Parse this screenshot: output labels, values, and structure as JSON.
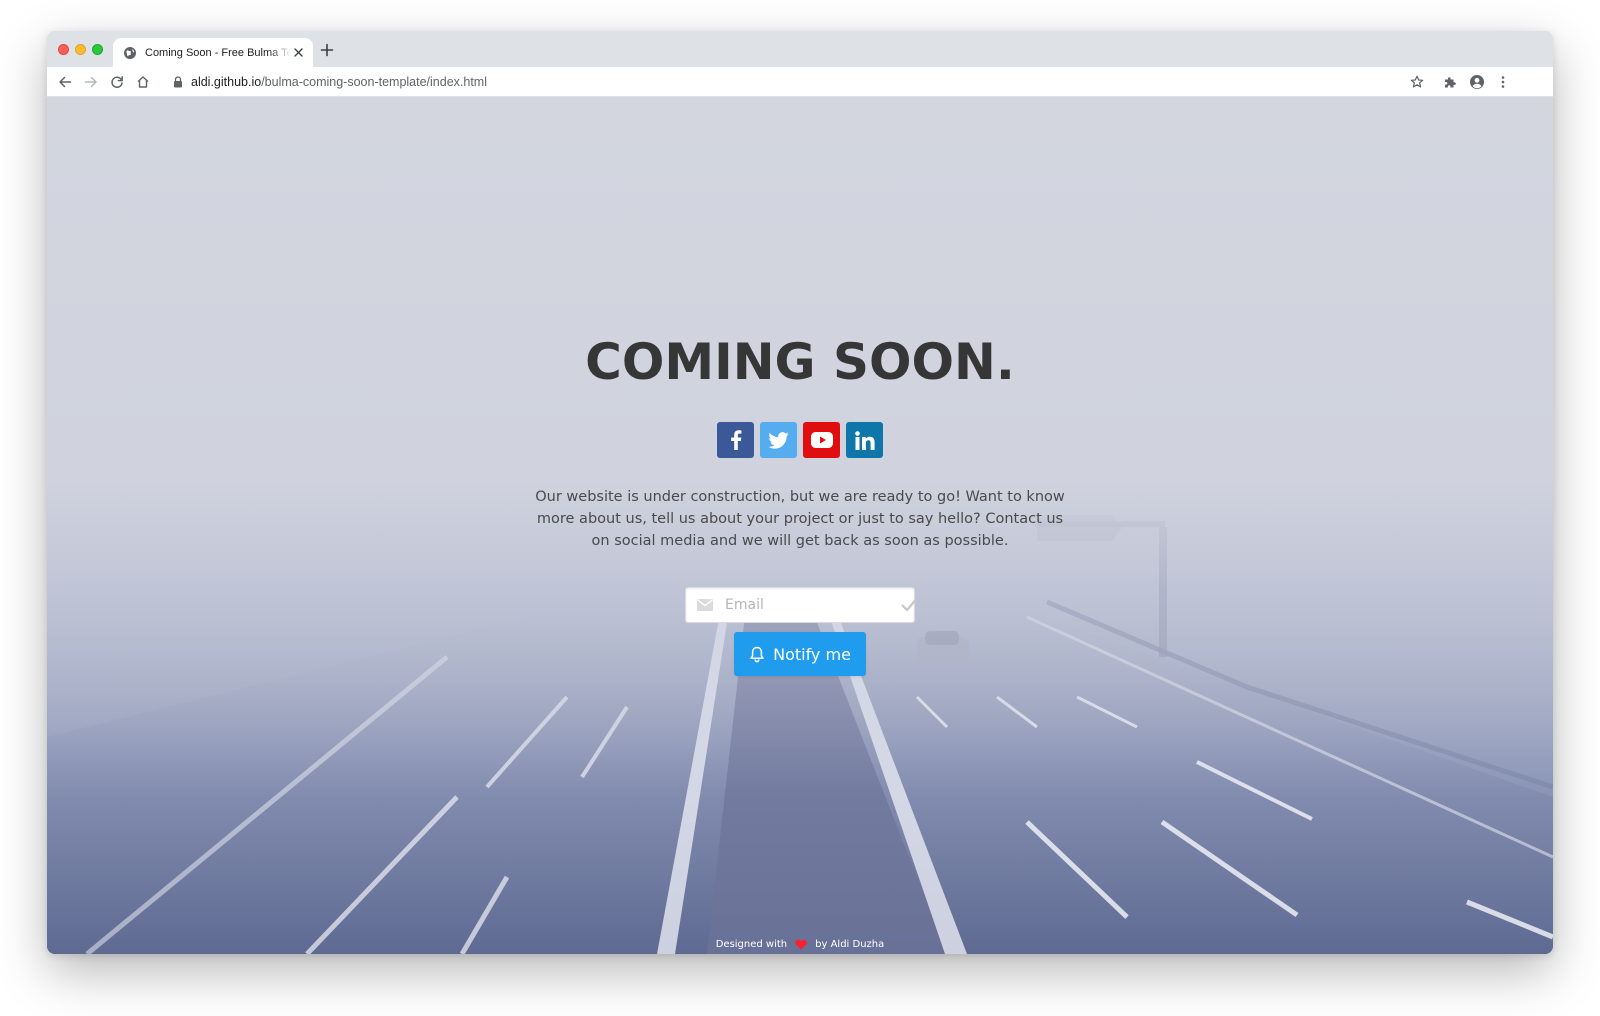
{
  "browser": {
    "tab": {
      "title": "Coming Soon - Free Bulma Template",
      "favicon": "globe-icon"
    },
    "url": {
      "host": "aldi.github.io",
      "path": "/bulma-coming-soon-template/index.html"
    },
    "icons": {
      "back": "arrow-left-icon",
      "forward": "arrow-right-icon",
      "reload": "reload-icon",
      "home": "home-icon",
      "lock": "lock-icon",
      "bookmark": "star-icon",
      "extensions": "puzzle-icon",
      "profile": "account-circle-icon",
      "menu": "kebab-menu-icon"
    }
  },
  "page": {
    "headline": "COMING SOON.",
    "socials": [
      {
        "name": "Facebook",
        "icon": "facebook-icon",
        "color": "#3b5998"
      },
      {
        "name": "Twitter",
        "icon": "twitter-icon",
        "color": "#55acee"
      },
      {
        "name": "YouTube",
        "icon": "youtube-icon",
        "color": "#e00e0e"
      },
      {
        "name": "LinkedIn",
        "icon": "linkedin-icon",
        "color": "#0e76a8"
      }
    ],
    "description_lines": [
      "Our website is under construction, but we are ready to go! Want to know",
      "more about us, tell us about your project or just to say hello? Contact us",
      "on social media and we will get back as soon as possible."
    ],
    "email": {
      "placeholder": "Email",
      "value": ""
    },
    "notify_button": {
      "label": "Notify me",
      "color": "#209cee"
    },
    "footer": {
      "prefix": "Designed with",
      "suffix": "by Aldi Duzha"
    }
  }
}
